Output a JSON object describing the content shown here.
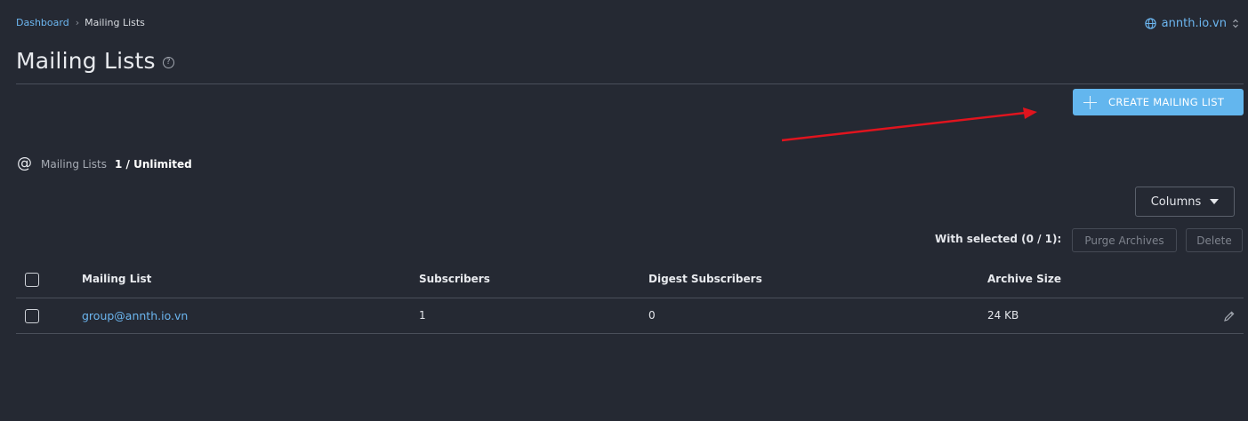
{
  "breadcrumb": {
    "root": "Dashboard",
    "current": "Mailing Lists"
  },
  "domain_switch": {
    "domain": "annth.io.vn",
    "icon": "globe-icon"
  },
  "page": {
    "title": "Mailing Lists",
    "help_icon": "?"
  },
  "actions": {
    "create_label": "CREATE MAILING LIST"
  },
  "usage": {
    "icon": "@",
    "label": "Mailing Lists",
    "value": "1 / Unlimited"
  },
  "toolbar": {
    "columns_label": "Columns",
    "with_selected": "With selected (0 / 1):",
    "purge_label": "Purge Archives",
    "delete_label": "Delete"
  },
  "table": {
    "headers": [
      "Mailing List",
      "Subscribers",
      "Digest Subscribers",
      "Archive Size"
    ],
    "rows": [
      {
        "mailing_list": "group@annth.io.vn",
        "subscribers": "1",
        "digest_subscribers": "0",
        "archive_size": "24 KB"
      }
    ]
  },
  "colors": {
    "background": "#252933",
    "accent": "#63b6ee",
    "link": "#6cb6f0",
    "annotation_arrow": "#e0141e"
  }
}
